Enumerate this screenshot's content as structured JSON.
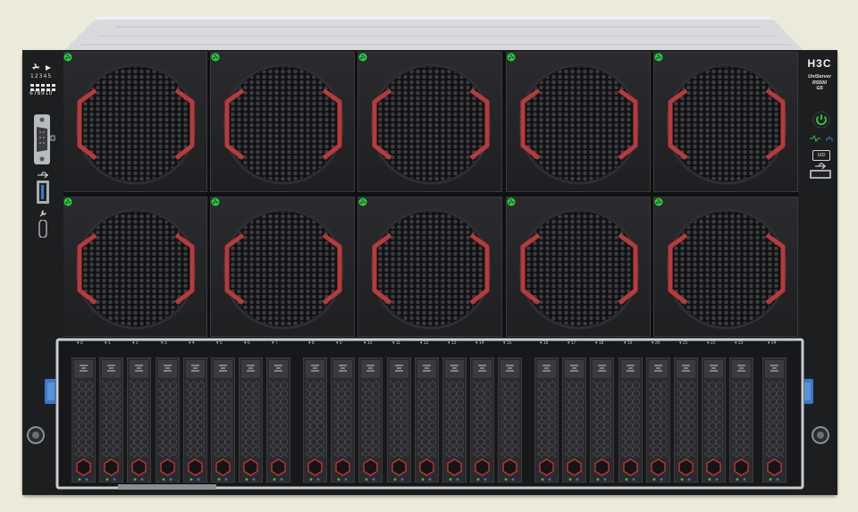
{
  "brand": "H3C",
  "model": [
    "UniServer",
    "R5500",
    "G5"
  ],
  "fan_modules": 10,
  "left_panel": {
    "fan_status_icon": "fan-icon",
    "diag_digits_row1": [
      "1",
      "2",
      "3",
      "4",
      "5"
    ],
    "diag_digits_row2": [
      "6",
      "7",
      "8",
      "9",
      "10"
    ],
    "ports": [
      "vga-port",
      "usb-port",
      "usb-c-port"
    ]
  },
  "right_panel": {
    "power_icon": "power-icon",
    "status_icons": [
      "health-icon",
      "network-icon"
    ],
    "uid_label": "UID",
    "usb_icon": "usb-icon"
  },
  "drive_slots": [
    "0",
    "1",
    "2",
    "3",
    "4",
    "5",
    "6",
    "7",
    "8",
    "9",
    "10",
    "11",
    "12",
    "13",
    "14",
    "15",
    "16",
    "17",
    "18",
    "19",
    "20",
    "21",
    "22",
    "23",
    "24"
  ],
  "colors": {
    "fan_bezel_accent": "#b83a3a",
    "led_green": "#2ecc40",
    "latch_blue": "#3a78c8",
    "drive_accent": "#c8332f"
  }
}
